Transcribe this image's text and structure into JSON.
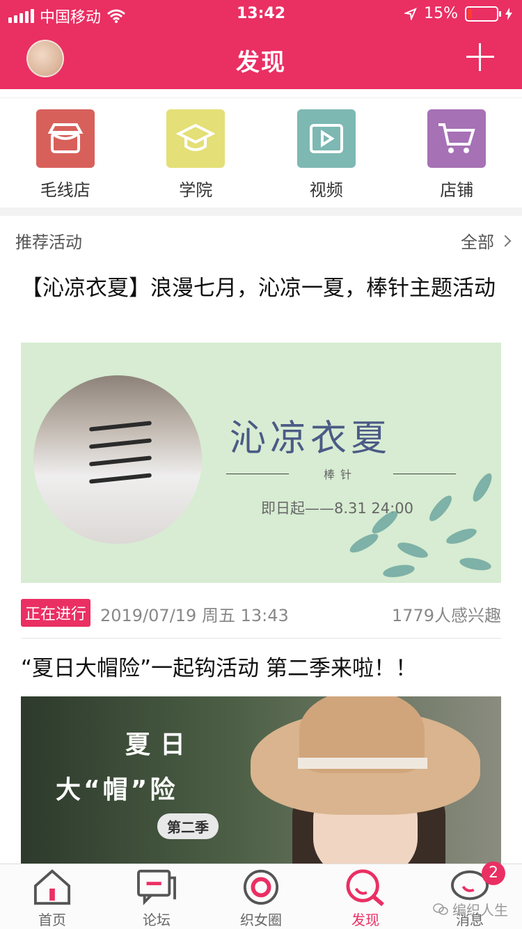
{
  "status_bar": {
    "carrier": "中国移动",
    "time": "13:42",
    "battery_percent": "15%",
    "battery_level": 0.15,
    "battery_color": "#ff3b30"
  },
  "header": {
    "title": "发现",
    "accent_color": "#ea2f63",
    "avatar_icon": "user-avatar",
    "action_icon": "plus-icon"
  },
  "quick_entries": [
    {
      "label": "毛线店",
      "icon": "shop-icon",
      "color": "#d8605b"
    },
    {
      "label": "学院",
      "icon": "graduation-cap-icon",
      "color": "#e4df76"
    },
    {
      "label": "视频",
      "icon": "video-play-icon",
      "color": "#7db8b3"
    },
    {
      "label": "店铺",
      "icon": "cart-icon",
      "color": "#a671b5"
    }
  ],
  "section": {
    "title": "推荐活动",
    "see_all": "全部"
  },
  "activities": [
    {
      "title": "【沁凉衣夏】浪漫七月，沁凉一夏，棒针主题活动",
      "banner": {
        "headline": "沁凉衣夏",
        "sub": "棒针",
        "date_line": "即日起——8.31 24:00"
      },
      "status": "正在进行",
      "date": "2019/07/19 周五 13:43",
      "interest": "1779人感兴趣"
    },
    {
      "title": "“夏日大帽险”一起钩活动 第二季来啦！！",
      "banner": {
        "line1": "夏日",
        "line2": "大“帽”险",
        "pill": "第二季"
      }
    }
  ],
  "tabbar": {
    "tabs": [
      {
        "label": "首页",
        "icon": "home-icon"
      },
      {
        "label": "论坛",
        "icon": "forum-icon"
      },
      {
        "label": "织女圈",
        "icon": "circle-icon"
      },
      {
        "label": "发现",
        "icon": "discover-icon"
      },
      {
        "label": "消息",
        "icon": "message-icon"
      }
    ],
    "active_index": 3,
    "message_badge": "2",
    "watermark": "编织人生"
  }
}
